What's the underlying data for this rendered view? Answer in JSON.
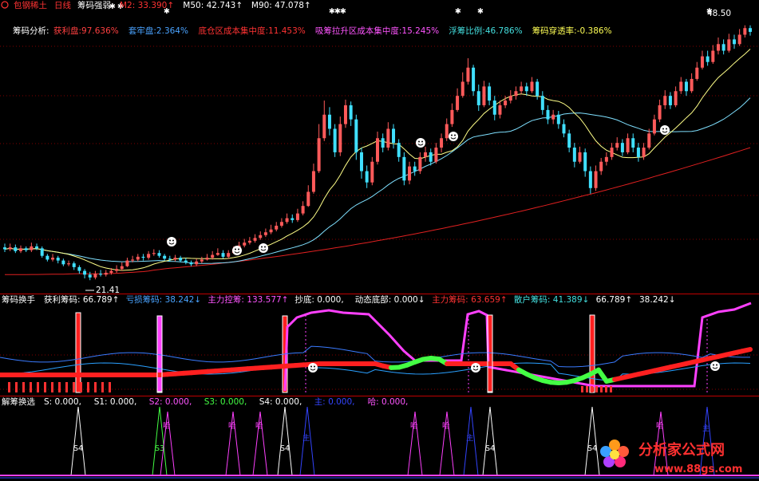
{
  "header": {
    "title": "包钢稀土",
    "period": "日线",
    "indicator": "筹码强弱",
    "ma_values": [
      {
        "label": "M2:",
        "value": "33.390",
        "arrow": "↑",
        "color": "#ff3333"
      },
      {
        "label": "M50:",
        "value": "42.743",
        "arrow": "↑",
        "color": "#ffffff"
      },
      {
        "label": "M90:",
        "value": "47.078",
        "arrow": "↑",
        "color": "#ffffff"
      }
    ]
  },
  "analysis": {
    "label": "筹码分析:",
    "items": [
      {
        "label": "获利盘:",
        "value": "97.636%",
        "color": "#ff4040"
      },
      {
        "label": "套牢盘:",
        "value": "2.364%",
        "color": "#4aa3ff"
      },
      {
        "label": "底仓区成本集中度:",
        "value": "11.453%",
        "color": "#ff3333"
      },
      {
        "label": "吸筹拉升区成本集中度:",
        "value": "15.245%",
        "color": "#ff55ff"
      },
      {
        "label": "浮筹比例:",
        "value": "46.786%",
        "color": "#44e0e0"
      },
      {
        "label": "筹码穿透率:",
        "value": "-0.386%",
        "color": "#ffff55"
      }
    ]
  },
  "price_labels": {
    "high": "48.50",
    "low": "21.41"
  },
  "panel2": {
    "title": "筹码换手",
    "items": [
      {
        "label": "获利筹码:",
        "value": "66.789",
        "arrow": "↑",
        "color": "#ffffff"
      },
      {
        "label": "亏损筹码:",
        "value": "38.242",
        "arrow": "↓",
        "color": "#4aa3ff"
      },
      {
        "label": "主力控筹:",
        "value": "133.577",
        "arrow": "↑",
        "color": "#ff55ff"
      },
      {
        "label": "抄底:",
        "value": "0.000",
        "arrow": ",",
        "color": "#ffffff"
      },
      {
        "label": "动态底部:",
        "value": "0.000",
        "arrow": "↓",
        "color": "#ffffff"
      },
      {
        "label": "主力筹码:",
        "value": "63.659",
        "arrow": "↑",
        "color": "#ff3333"
      },
      {
        "label": "散户筹码:",
        "value": "41.389",
        "arrow": "↓",
        "color": "#44e0e0"
      },
      {
        "label": "",
        "value": "66.789",
        "arrow": "↑",
        "color": "#ffffff"
      },
      {
        "label": "",
        "value": "38.242",
        "arrow": "↓",
        "color": "#ffffff"
      }
    ]
  },
  "panel3": {
    "title": "解筹换选",
    "items": [
      {
        "label": "S:",
        "value": "0.000,",
        "color": "#ffffff"
      },
      {
        "label": "S1:",
        "value": "0.000,",
        "color": "#ffffff"
      },
      {
        "label": "S2:",
        "value": "0.000,",
        "color": "#ff55ff"
      },
      {
        "label": "S3:",
        "value": "0.000,",
        "color": "#44ff44"
      },
      {
        "label": "S4:",
        "value": "0.000,",
        "color": "#ffffff"
      },
      {
        "label": "主:",
        "value": "0.000,",
        "color": "#3344ff"
      },
      {
        "label": "哈:",
        "value": "0.000,",
        "color": "#ff55ff"
      }
    ],
    "signal_labels": {
      "s3": "S3",
      "s4": "S4",
      "ha": "哈",
      "zhu": "主"
    }
  },
  "watermark": {
    "name": "分析家公式网",
    "url": "www.88gs.com"
  },
  "colors": {
    "up": "#ff5a5a",
    "down": "#40e0ff",
    "ma_fast": "#ffff88",
    "ma_slow": "#7fe0ff",
    "ma_long": "#e02020",
    "magenta": "#ff40ff",
    "blue": "#3a7bff",
    "grid": "#800000"
  },
  "chart_data": {
    "type": "candlestick",
    "ylim": [
      20.5,
      50
    ],
    "candles": [
      [
        24.9,
        24.7,
        25.3,
        24.4
      ],
      [
        24.7,
        24.9,
        25.3,
        24.5
      ],
      [
        24.9,
        24.5,
        25.2,
        24.3
      ],
      [
        24.5,
        24.8,
        25.1,
        24.3
      ],
      [
        24.8,
        24.6,
        25.0,
        24.4
      ],
      [
        24.6,
        25.0,
        25.4,
        24.4
      ],
      [
        25.0,
        24.8,
        25.3,
        24.6
      ],
      [
        24.8,
        24.0,
        25.0,
        23.8
      ],
      [
        24.0,
        23.6,
        24.2,
        23.4
      ],
      [
        23.6,
        23.8,
        24.2,
        23.4
      ],
      [
        23.8,
        23.5,
        24.0,
        23.2
      ],
      [
        23.5,
        23.1,
        23.7,
        22.9
      ],
      [
        23.1,
        23.2,
        23.5,
        22.9
      ],
      [
        23.2,
        22.8,
        23.4,
        22.5
      ],
      [
        22.8,
        22.4,
        23.0,
        22.1
      ],
      [
        22.4,
        22.0,
        22.6,
        21.6
      ],
      [
        22.0,
        21.7,
        22.3,
        21.41
      ],
      [
        21.7,
        22.1,
        22.4,
        21.5
      ],
      [
        22.1,
        22.0,
        22.5,
        21.8
      ],
      [
        22.0,
        22.2,
        22.5,
        21.8
      ],
      [
        22.2,
        22.4,
        22.7,
        22.0
      ],
      [
        22.4,
        22.6,
        23.0,
        22.2
      ],
      [
        22.6,
        22.9,
        23.3,
        22.4
      ],
      [
        22.9,
        23.5,
        23.8,
        22.8
      ],
      [
        23.5,
        23.6,
        24.0,
        23.3
      ],
      [
        23.6,
        23.9,
        24.2,
        23.4
      ],
      [
        23.9,
        23.8,
        24.2,
        23.5
      ],
      [
        23.8,
        24.2,
        24.5,
        23.6
      ],
      [
        24.2,
        24.3,
        24.7,
        24.0
      ],
      [
        24.3,
        24.0,
        24.6,
        23.8
      ],
      [
        24.0,
        23.7,
        24.2,
        23.5
      ],
      [
        23.7,
        23.6,
        24.0,
        23.4
      ],
      [
        23.6,
        23.8,
        24.1,
        23.4
      ],
      [
        23.8,
        23.5,
        24.0,
        23.3
      ],
      [
        23.5,
        23.3,
        23.8,
        23.1
      ],
      [
        23.3,
        23.1,
        23.5,
        22.9
      ],
      [
        23.1,
        23.4,
        23.7,
        22.9
      ],
      [
        23.4,
        23.6,
        23.9,
        23.2
      ],
      [
        23.6,
        23.8,
        24.2,
        23.5
      ],
      [
        23.8,
        24.1,
        24.5,
        23.6
      ],
      [
        24.1,
        24.3,
        24.8,
        24.0
      ],
      [
        24.3,
        23.9,
        24.6,
        23.7
      ],
      [
        23.9,
        24.3,
        24.6,
        23.7
      ],
      [
        24.3,
        24.7,
        25.0,
        24.2
      ],
      [
        24.7,
        25.1,
        25.5,
        24.6
      ],
      [
        25.1,
        25.4,
        25.8,
        24.9
      ],
      [
        25.4,
        25.6,
        26.0,
        25.2
      ],
      [
        25.6,
        25.9,
        26.3,
        25.4
      ],
      [
        25.9,
        26.2,
        26.6,
        25.7
      ],
      [
        26.2,
        26.5,
        26.9,
        26.0
      ],
      [
        26.5,
        26.8,
        27.3,
        26.3
      ],
      [
        26.8,
        27.2,
        27.6,
        26.6
      ],
      [
        27.2,
        27.6,
        28.0,
        27.0
      ],
      [
        27.6,
        28.0,
        28.5,
        27.4
      ],
      [
        28.0,
        27.8,
        28.4,
        27.5
      ],
      [
        27.8,
        28.5,
        29.0,
        27.6
      ],
      [
        28.5,
        29.3,
        29.8,
        28.3
      ],
      [
        29.3,
        30.8,
        31.5,
        29.2
      ],
      [
        30.8,
        33.0,
        33.8,
        30.6
      ],
      [
        33.0,
        36.5,
        38.0,
        32.8
      ],
      [
        36.5,
        39.0,
        40.5,
        36.2
      ],
      [
        39.0,
        37.5,
        39.8,
        36.8
      ],
      [
        37.5,
        35.0,
        38.0,
        34.5
      ],
      [
        35.0,
        38.0,
        38.8,
        34.6
      ],
      [
        38.0,
        40.0,
        40.6,
        37.6
      ],
      [
        40.0,
        38.5,
        40.4,
        37.8
      ],
      [
        38.5,
        35.0,
        39.0,
        34.2
      ],
      [
        35.0,
        33.0,
        35.5,
        32.2
      ],
      [
        33.0,
        31.8,
        33.6,
        31.2
      ],
      [
        31.8,
        34.0,
        34.5,
        31.5
      ],
      [
        34.0,
        36.5,
        37.2,
        33.7
      ],
      [
        36.5,
        35.5,
        37.0,
        35.0
      ],
      [
        35.5,
        37.5,
        38.2,
        35.2
      ],
      [
        37.5,
        36.0,
        38.0,
        35.4
      ],
      [
        36.0,
        34.5,
        36.4,
        34.0
      ],
      [
        34.5,
        32.0,
        35.0,
        31.5
      ],
      [
        32.0,
        33.5,
        34.0,
        31.6
      ],
      [
        33.5,
        33.0,
        34.0,
        32.5
      ],
      [
        33.0,
        34.5,
        35.0,
        32.7
      ],
      [
        34.5,
        35.0,
        35.6,
        34.0
      ],
      [
        35.0,
        34.0,
        35.4,
        33.6
      ],
      [
        34.0,
        35.5,
        36.0,
        33.8
      ],
      [
        35.5,
        36.5,
        37.0,
        35.0
      ],
      [
        36.5,
        38.0,
        38.6,
        36.2
      ],
      [
        38.0,
        39.5,
        40.2,
        37.7
      ],
      [
        39.5,
        41.0,
        41.8,
        39.3
      ],
      [
        41.0,
        42.5,
        43.5,
        40.8
      ],
      [
        42.5,
        44.0,
        45.0,
        42.2
      ],
      [
        44.0,
        41.5,
        44.3,
        41.0
      ],
      [
        41.5,
        40.0,
        42.2,
        39.4
      ],
      [
        40.0,
        42.0,
        42.6,
        39.8
      ],
      [
        42.0,
        40.5,
        42.4,
        40.0
      ],
      [
        40.5,
        39.0,
        41.0,
        38.4
      ],
      [
        39.0,
        40.0,
        40.5,
        38.6
      ],
      [
        40.0,
        40.5,
        41.0,
        39.7
      ],
      [
        40.5,
        41.0,
        41.6,
        40.2
      ],
      [
        41.0,
        41.5,
        42.0,
        40.6
      ],
      [
        41.5,
        42.0,
        42.5,
        41.2
      ],
      [
        42.0,
        41.5,
        42.4,
        41.0
      ],
      [
        41.5,
        42.5,
        43.0,
        41.3
      ],
      [
        42.5,
        41.0,
        42.8,
        40.6
      ],
      [
        41.0,
        39.5,
        41.5,
        39.0
      ],
      [
        39.5,
        38.5,
        40.0,
        38.0
      ],
      [
        38.5,
        39.0,
        39.5,
        38.0
      ],
      [
        39.0,
        38.0,
        39.4,
        37.5
      ],
      [
        38.0,
        37.0,
        38.5,
        36.6
      ],
      [
        37.0,
        35.5,
        37.4,
        35.0
      ],
      [
        35.5,
        34.0,
        36.0,
        33.4
      ],
      [
        34.0,
        35.0,
        35.6,
        33.8
      ],
      [
        35.0,
        33.0,
        35.4,
        32.4
      ],
      [
        33.0,
        31.2,
        33.5,
        30.6
      ],
      [
        31.2,
        33.0,
        33.6,
        30.9
      ],
      [
        33.0,
        34.0,
        34.4,
        32.6
      ],
      [
        34.0,
        34.5,
        35.0,
        33.6
      ],
      [
        34.5,
        35.5,
        36.0,
        34.2
      ],
      [
        35.5,
        36.0,
        36.6,
        35.2
      ],
      [
        36.0,
        35.0,
        36.4,
        34.6
      ],
      [
        35.0,
        36.5,
        37.0,
        34.8
      ],
      [
        36.5,
        35.5,
        37.0,
        35.0
      ],
      [
        35.5,
        34.5,
        36.0,
        34.0
      ],
      [
        34.5,
        35.5,
        36.0,
        34.2
      ],
      [
        35.5,
        37.0,
        37.5,
        35.3
      ],
      [
        37.0,
        38.5,
        39.0,
        36.8
      ],
      [
        38.5,
        40.0,
        40.6,
        38.2
      ],
      [
        40.0,
        41.0,
        41.6,
        39.6
      ],
      [
        41.0,
        40.0,
        41.4,
        39.6
      ],
      [
        40.0,
        41.5,
        42.0,
        39.8
      ],
      [
        41.5,
        42.5,
        43.0,
        41.2
      ],
      [
        42.5,
        41.5,
        42.8,
        41.0
      ],
      [
        41.5,
        42.8,
        43.4,
        41.3
      ],
      [
        42.8,
        44.0,
        44.6,
        42.6
      ],
      [
        44.0,
        45.2,
        45.8,
        43.8
      ],
      [
        45.2,
        44.6,
        45.8,
        44.2
      ],
      [
        44.6,
        45.8,
        46.4,
        44.4
      ],
      [
        45.8,
        46.5,
        47.2,
        45.4
      ],
      [
        46.5,
        45.8,
        47.0,
        45.4
      ],
      [
        45.8,
        47.0,
        47.6,
        45.6
      ],
      [
        47.0,
        46.5,
        47.5,
        46.0
      ],
      [
        46.5,
        47.5,
        48.1,
        46.3
      ],
      [
        47.5,
        48.2,
        48.5,
        47.2
      ],
      [
        48.2,
        47.8,
        48.5,
        47.4
      ]
    ]
  }
}
